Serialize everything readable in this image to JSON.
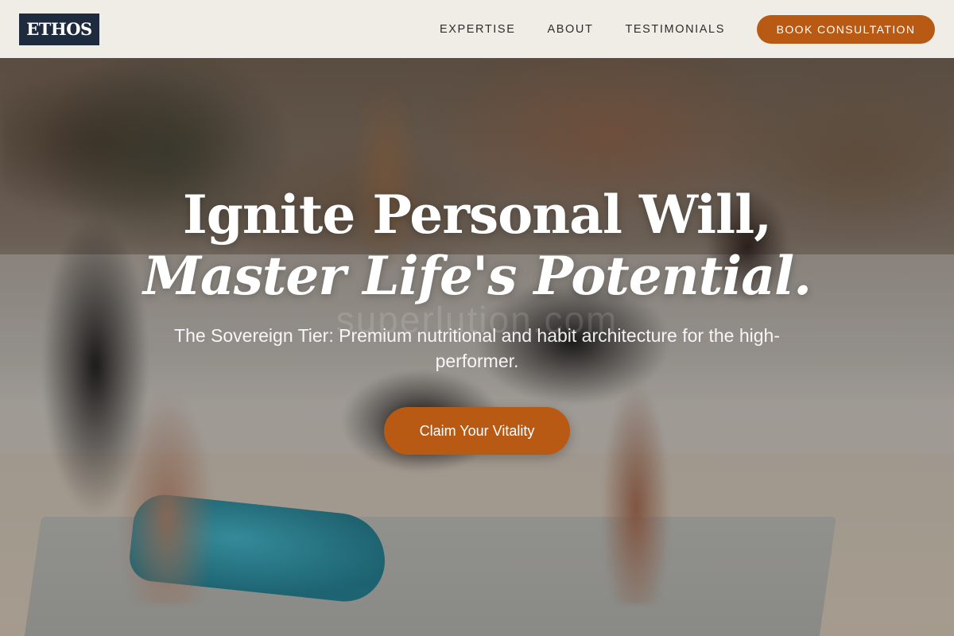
{
  "brand": {
    "logo_text": "ETHOS"
  },
  "nav": {
    "links": [
      {
        "label": "EXPERTISE"
      },
      {
        "label": "ABOUT"
      },
      {
        "label": "TESTIMONIALS"
      }
    ],
    "cta_label": "BOOK CONSULTATION"
  },
  "hero": {
    "headline_line1": "Ignite Personal Will,",
    "headline_line2": "Master Life's Potential.",
    "subtitle": "The Sovereign Tier: Premium nutritional and habit architecture for the high-performer.",
    "cta_label": "Claim Your Vitality",
    "watermark": "superlution.com"
  },
  "colors": {
    "accent": "#b85a14",
    "logo_bg": "#1e2a3e",
    "header_bg": "#f7f4ee",
    "cushion": "#2a8da0"
  }
}
